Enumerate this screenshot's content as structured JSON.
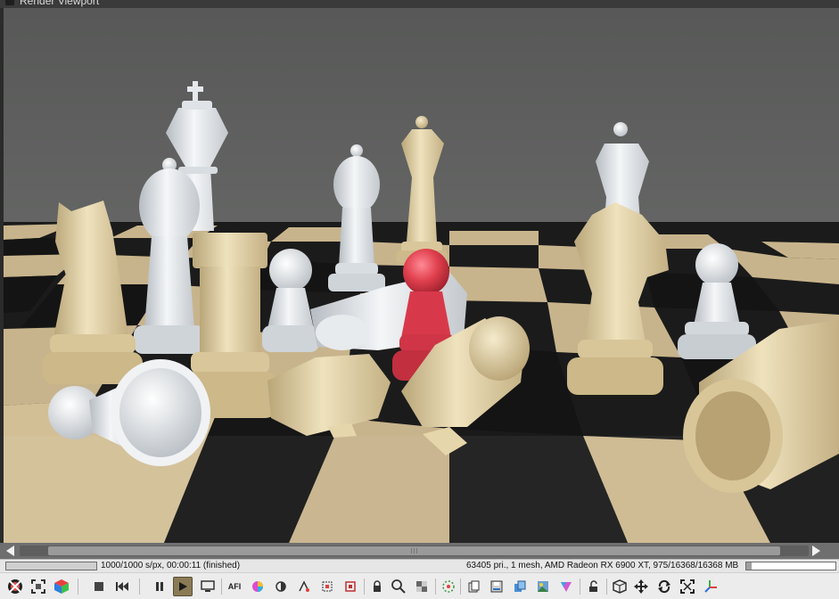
{
  "window": {
    "title": "Render Viewport"
  },
  "render": {
    "description_alt": "Chess pieces render",
    "progress_fraction": 1.0,
    "status_left": "1000/1000 s/px, 00:00:11 (finished)",
    "status_right": "63405 pri., 1 mesh, AMD Radeon RX 6900 XT, 975/16368/16368 MB",
    "vram_used_fraction": 0.06
  },
  "colors": {
    "background_wall": "#595a59",
    "board_light": "#c8b48c",
    "board_dark": "#141414",
    "piece_cream": "#e4d4a8",
    "piece_white": "#e9ecef",
    "piece_red": "#e0404e",
    "active_button": "#8a7a55"
  },
  "toolbar": {
    "buttons": [
      {
        "name": "camera-settings-icon",
        "tooltip": ""
      },
      {
        "name": "fit-view-icon",
        "tooltip": ""
      },
      {
        "name": "color-cube-icon",
        "tooltip": ""
      },
      {
        "name": "stop-icon",
        "tooltip": ""
      },
      {
        "name": "restart-icon",
        "tooltip": ""
      },
      {
        "name": "pause-icon",
        "tooltip": ""
      },
      {
        "name": "play-icon",
        "tooltip": ""
      },
      {
        "name": "display-icon",
        "tooltip": ""
      }
    ],
    "labels": {
      "afi": "AFI"
    }
  }
}
